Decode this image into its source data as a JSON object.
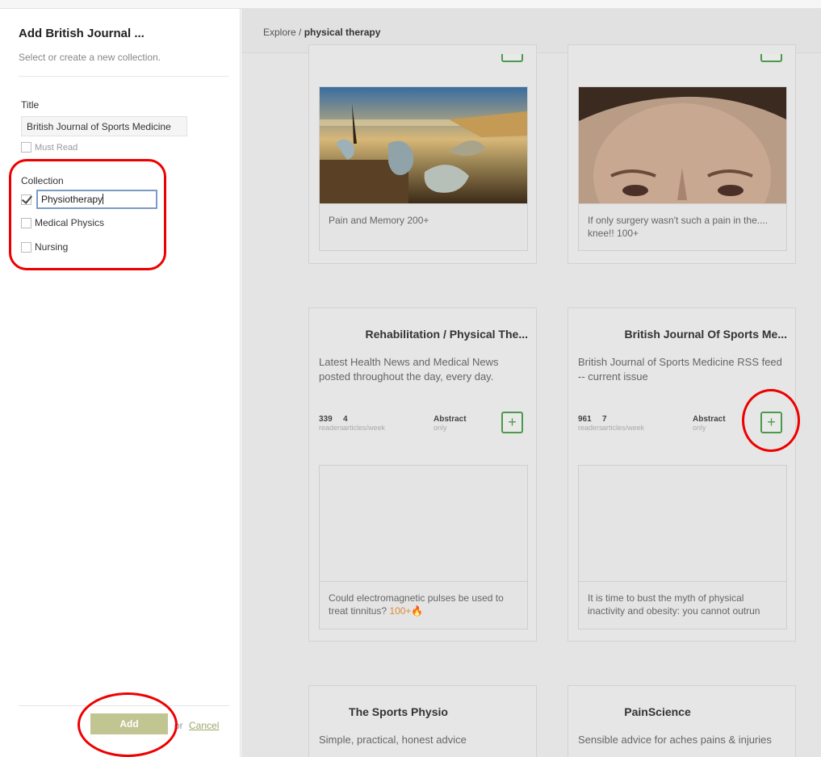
{
  "panel": {
    "title": "Add British Journal ...",
    "subtitle": "Select or create a new collection.",
    "title_label": "Title",
    "title_value": "British Journal of Sports Medicine",
    "must_read_label": "Must Read",
    "collection_label": "Collection",
    "collections": [
      {
        "label": "Physiotherapy",
        "checked": true,
        "editing": true
      },
      {
        "label": "Medical Physics",
        "checked": false
      },
      {
        "label": "Nursing",
        "checked": false
      }
    ],
    "add_label": "Add",
    "or_label": "or",
    "cancel_label": "Cancel"
  },
  "main": {
    "breadcrumb_root": "Explore /",
    "breadcrumb_current": "physical therapy",
    "cards": [
      {
        "article": "Pain and Memory 200+"
      },
      {
        "article": "If only surgery wasn't such a pain in the.... knee!! 100+"
      },
      {
        "title": "Rehabilitation / Physical The...",
        "description": "Latest Health News and Medical News posted throughout the day, every day.",
        "readers": "339",
        "readers_label": "readers",
        "articles_week": "4",
        "articles_week_label": "articles/week",
        "type": "Abstract",
        "type_sub": "only",
        "article": "Could electromagnetic pulses be used to treat tinnitus?",
        "article_count": "100+"
      },
      {
        "title": "British Journal Of Sports Me...",
        "description": "British Journal of Sports Medicine RSS feed -- current issue",
        "readers": "961",
        "readers_label": "readers",
        "articles_week": "7",
        "articles_week_label": "articles/week",
        "type": "Abstract",
        "type_sub": "only",
        "article": "It is time to bust the myth of physical inactivity and obesity: you cannot outrun"
      },
      {
        "title": "The Sports Physio",
        "description": "Simple, practical, honest advice"
      },
      {
        "title": "PainScience",
        "description": "Sensible advice for aches pains & injuries"
      }
    ],
    "plus_label": "+"
  },
  "colors": {
    "add_button": "#c1c591",
    "follow_green": "#4a9a4a",
    "annotation_red": "#e00000",
    "count_orange": "#e08a3a"
  }
}
